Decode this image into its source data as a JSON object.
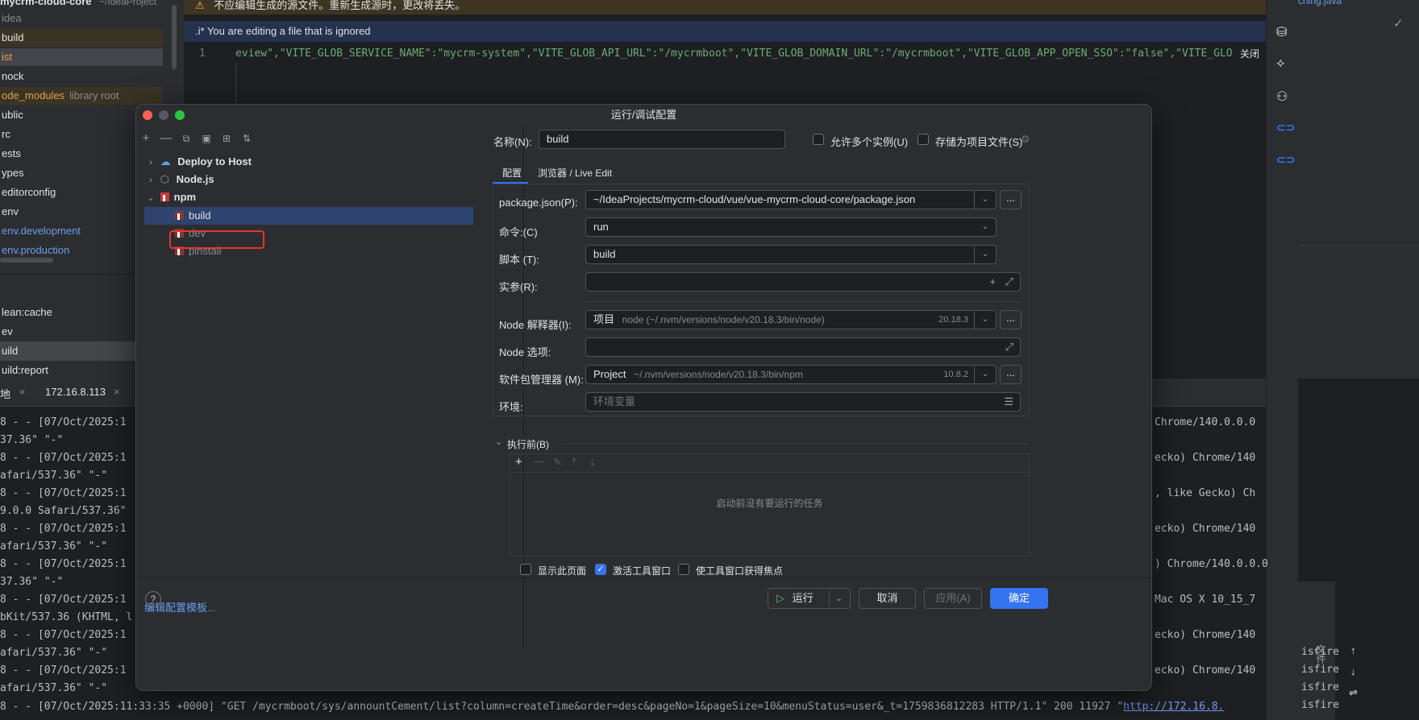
{
  "ide": {
    "project_header": "mycrm-cloud-core",
    "project_path": "~/IdeaProject",
    "project_tree": [
      {
        "label": "idea",
        "color": "#868a91"
      },
      {
        "label": "build",
        "color": "#dfe1e5"
      },
      {
        "label": "ist",
        "color": "#e0a050"
      },
      {
        "label": "nock",
        "color": "#dfe1e5"
      },
      {
        "label": "ode_modules",
        "color": "#e0a050"
      },
      {
        "label": "ublic",
        "color": "#dfe1e5"
      },
      {
        "label": "rc",
        "color": "#dfe1e5"
      },
      {
        "label": "ests",
        "color": "#dfe1e5"
      },
      {
        "label": "ypes",
        "color": "#dfe1e5"
      },
      {
        "label": "editorconfig",
        "color": "#dfe1e5"
      },
      {
        "label": "env",
        "color": "#dfe1e5"
      },
      {
        "label": "env.development",
        "color": "#6b9bf0"
      },
      {
        "label": "env.production",
        "color": "#6b9bf0"
      }
    ],
    "library_root": "library root",
    "npm_scripts": [
      "lean:cache",
      "ev",
      "uild",
      "uild:report"
    ],
    "banner": "不应编辑生成的源文件。重新生成源时，更改将丢失。",
    "ignored_notice": ".i* You are editing a file that is ignored",
    "line_number": "1",
    "code_line": "eview\",\"VITE_GLOB_SERVICE_NAME\":\"mycrm-system\",\"VITE_GLOB_API_URL\":\"/mycrmboot\",\"VITE_GLOB_DOMAIN_URL\":\"/mycrmboot\",\"VITE_GLOB_APP_OPEN_SSO\":\"false\",\"VITE_GLO",
    "close_hint": "关闭",
    "right_panel_file": "ching.java",
    "run_tabs": [
      "地",
      "172.16.8.113"
    ],
    "log_left": [
      "8 - - [07/Oct/2025:1",
      "37.36\" \"-\"",
      "8 - - [07/Oct/2025:1",
      "afari/537.36\" \"-\"",
      "8 - - [07/Oct/2025:1",
      "9.0.0 Safari/537.36\"",
      "8 - - [07/Oct/2025:1",
      "afari/537.36\" \"-\"",
      "8 - - [07/Oct/2025:1",
      "37.36\" \"-\"",
      "8 - - [07/Oct/2025:1",
      "bKit/537.36 (KHTML, l",
      "8 - - [07/Oct/2025:1",
      "afari/537.36\" \"-\"",
      "8 - - [07/Oct/2025:1",
      "afari/537.36\" \"-\""
    ],
    "log_right": [
      "Chrome/140.0.0.0",
      "ecko) Chrome/140",
      ", like Gecko) Ch",
      "ecko) Chrome/140",
      ") Chrome/140.0.0.0",
      "Mac OS X 10_15_7",
      "ecko) Chrome/140",
      "ecko) Chrome/140"
    ],
    "log_bottom": "8 - - [07/Oct/2025:11:33:35 +0000] \"GET /mycrmboot/sys/annountCement/list?column=createTime&order=desc&pageNo=1&pageSize=10&menuStatus=user&_t=1759836812283 HTTP/1.1\" 200 11927 \"",
    "log_bottom_link": "http://172.16.8.",
    "isfire": [
      "isfire",
      "isfire",
      "isfire",
      "isfire"
    ],
    "side_label": "文件"
  },
  "dialog": {
    "title": "运行/调试配置",
    "tree": {
      "deploy": "Deploy to Host",
      "nodejs": "Node.js",
      "npm": "npm",
      "items": [
        "build",
        "dev",
        "pinstall"
      ]
    },
    "edit_templates": "编辑配置模板...",
    "name_label": "名称(N):",
    "name_value": "build",
    "allow_multiple": "允许多个实例(U)",
    "store_as_project": "存储为项目文件(S)",
    "tabs": [
      "配置",
      "浏览器 / Live Edit"
    ],
    "package_json_label": "package.json(P):",
    "package_json_value": "~/IdeaProjects/mycrm-cloud/vue/vue-mycrm-cloud-core/package.json",
    "command_label": "命令:(C)",
    "command_value": "run",
    "script_label": "脚本 (T):",
    "script_value": "build",
    "args_label": "实参(R):",
    "args_value": "",
    "node_interp_label": "Node 解释器(I):",
    "node_interp_kind": "项目",
    "node_interp_path": "node (~/.nvm/versions/node/v20.18.3/bin/node)",
    "node_interp_version": "20.18.3",
    "node_options_label": "Node 选项:",
    "pkg_manager_label": "软件包管理器 (M):",
    "pkg_manager_kind": "Project",
    "pkg_manager_path": "~/.nvm/versions/node/v20.18.3/bin/npm",
    "pkg_manager_version": "10.8.2",
    "env_label": "环境:",
    "env_placeholder": "环境变量",
    "before_launch": "执行前(B)",
    "no_tasks": "启动前没有要运行的任务",
    "show_page": "显示此页面",
    "activate_tool_window": "激活工具窗口",
    "focus_tool_window": "使工具窗口获得焦点",
    "run_button": "运行",
    "cancel_button": "取消",
    "apply_button": "应用(A)",
    "ok_button": "确定",
    "help": "?"
  },
  "colors": {
    "accent": "#3574f0",
    "selection": "#2e436e",
    "highlight_box": "#e5372c"
  }
}
